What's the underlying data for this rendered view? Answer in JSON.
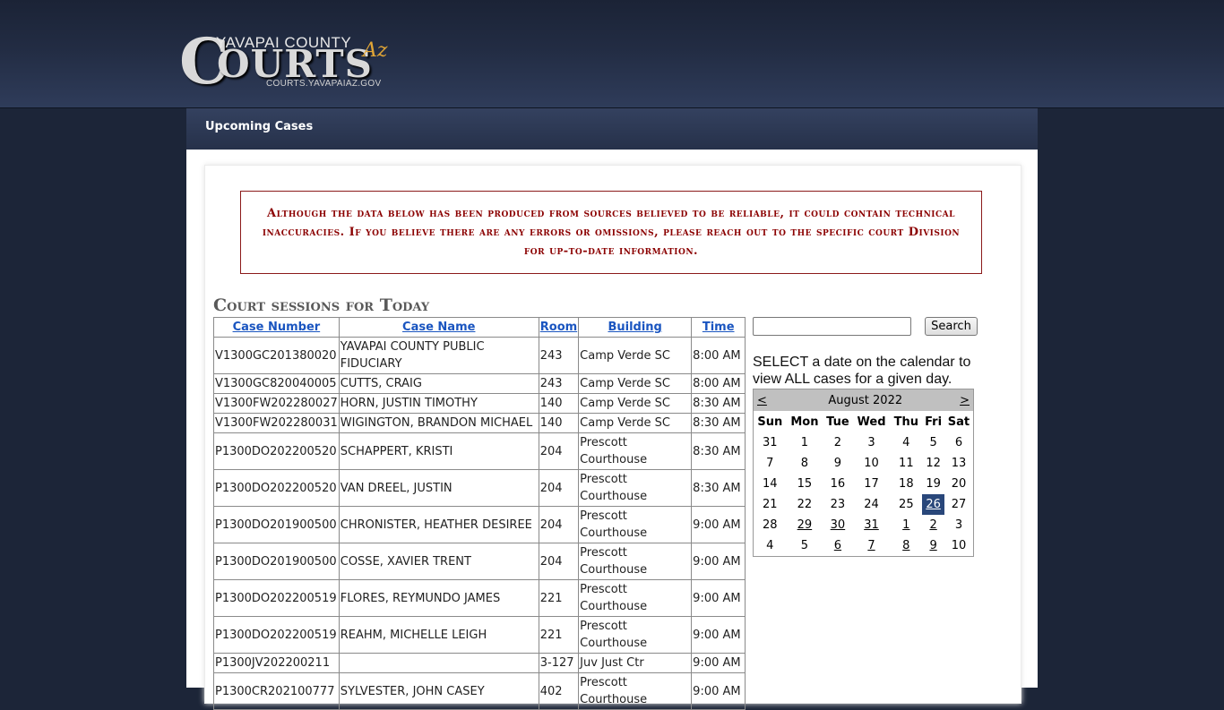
{
  "header": {
    "logo_top": "YAVAPAI COUNTY",
    "logo_c": "C",
    "logo_rest": "OURTS",
    "logo_az": "Az",
    "logo_url": "COURTS.YAVAPAIAZ.GOV"
  },
  "nav": {
    "title": "Upcoming Cases"
  },
  "notice": "Although the data below has been produced from sources believed to be reliable, it could contain technical inaccuracies. If you believe there are any errors or omissions, please reach out to the specific court Division for up-to-date information.",
  "sessions": {
    "title": "Court sessions for Today",
    "columns": [
      "Case Number",
      "Case Name",
      "Room",
      "Building",
      "Time"
    ],
    "rows": [
      {
        "num": "V1300GC201380020",
        "name": "YAVAPAI COUNTY PUBLIC FIDUCIARY",
        "room": "243",
        "building": "Camp Verde SC",
        "time": "8:00 AM"
      },
      {
        "num": "V1300GC820040005",
        "name": "CUTTS, CRAIG",
        "room": "243",
        "building": "Camp Verde SC",
        "time": "8:00 AM"
      },
      {
        "num": "V1300FW202280027",
        "name": "HORN, JUSTIN TIMOTHY",
        "room": "140",
        "building": "Camp Verde SC",
        "time": "8:30 AM"
      },
      {
        "num": "V1300FW202280031",
        "name": "WIGINGTON, BRANDON MICHAEL",
        "room": "140",
        "building": "Camp Verde SC",
        "time": "8:30 AM"
      },
      {
        "num": "P1300DO202200520",
        "name": "SCHAPPERT, KRISTI",
        "room": "204",
        "building": "Prescott Courthouse",
        "time": "8:30 AM"
      },
      {
        "num": "P1300DO202200520",
        "name": "VAN DREEL, JUSTIN",
        "room": "204",
        "building": "Prescott Courthouse",
        "time": "8:30 AM"
      },
      {
        "num": "P1300DO201900500",
        "name": "CHRONISTER, HEATHER DESIREE",
        "room": "204",
        "building": "Prescott Courthouse",
        "time": "9:00 AM"
      },
      {
        "num": "P1300DO201900500",
        "name": "COSSE, XAVIER TRENT",
        "room": "204",
        "building": "Prescott Courthouse",
        "time": "9:00 AM"
      },
      {
        "num": "P1300DO202200519",
        "name": "FLORES, REYMUNDO JAMES",
        "room": "221",
        "building": "Prescott Courthouse",
        "time": "9:00 AM"
      },
      {
        "num": "P1300DO202200519",
        "name": "REAHM, MICHELLE LEIGH",
        "room": "221",
        "building": "Prescott Courthouse",
        "time": "9:00 AM"
      },
      {
        "num": "P1300JV202200211",
        "name": "",
        "room": "3-127",
        "building": "Juv Just Ctr",
        "time": "9:00 AM"
      },
      {
        "num": "P1300CR202100777",
        "name": "SYLVESTER, JOHN CASEY",
        "room": "402",
        "building": "Prescott Courthouse",
        "time": "9:00 AM"
      }
    ]
  },
  "search": {
    "button_label": "Search",
    "value": ""
  },
  "calendar": {
    "instructions": "SELECT a date on the calendar to view ALL cases for a given day.",
    "prev": "<",
    "next": ">",
    "month": "August 2022",
    "days_of_week": [
      "Sun",
      "Mon",
      "Tue",
      "Wed",
      "Thu",
      "Fri",
      "Sat"
    ],
    "weeks": [
      [
        "31",
        "1",
        "2",
        "3",
        "4",
        "5",
        "6"
      ],
      [
        "7",
        "8",
        "9",
        "10",
        "11",
        "12",
        "13"
      ],
      [
        "14",
        "15",
        "16",
        "17",
        "18",
        "19",
        "20"
      ],
      [
        "21",
        "22",
        "23",
        "24",
        "25",
        "26",
        "27"
      ],
      [
        "28",
        "29",
        "30",
        "31",
        "1",
        "2",
        "3"
      ],
      [
        "4",
        "5",
        "6",
        "7",
        "8",
        "9",
        "10"
      ]
    ],
    "selected": "26"
  }
}
